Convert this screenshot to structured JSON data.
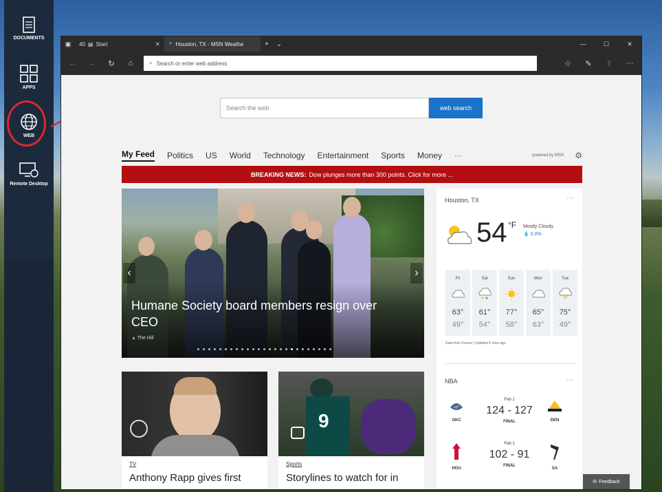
{
  "launcher": {
    "items": [
      {
        "label": "DOCUMENTS",
        "icon": "document-icon"
      },
      {
        "label": "APPS",
        "icon": "apps-grid-icon"
      },
      {
        "label": "WEB",
        "icon": "globe-icon"
      },
      {
        "label": "Remote Desktop",
        "icon": "remote-desktop-icon"
      }
    ]
  },
  "browser": {
    "tabs": {
      "start_count": "40",
      "start_label": "Start",
      "active_label": "Houston, TX - MSN Weathe"
    },
    "address_placeholder": "Search or enter web address"
  },
  "page": {
    "search_placeholder": "Search the web",
    "search_button": "web search",
    "feed_nav": [
      "My Feed",
      "Politics",
      "US",
      "World",
      "Technology",
      "Entertainment",
      "Sports",
      "Money"
    ],
    "feed_more": "···",
    "powered_by": "powered by MSN",
    "breaking_label": "BREAKING NEWS:",
    "breaking_text": "Dow plunges more than 300 points. Click for more ...",
    "hero": {
      "title": "Humane Society board members resign over CEO",
      "source": "The Hill"
    },
    "cards": [
      {
        "category": "TV",
        "title": "Anthony Rapp gives first"
      },
      {
        "category": "Sports",
        "title": "Storylines to watch for in"
      }
    ]
  },
  "weather": {
    "location": "Houston, TX",
    "more": "···",
    "temp": "54",
    "unit": "°F",
    "condition": "Mostly Cloudy",
    "precip": "0.0%",
    "forecast": [
      {
        "day": "Fri",
        "hi": "63°",
        "lo": "49°",
        "icon": "cloudy-icon"
      },
      {
        "day": "Sat",
        "hi": "61°",
        "lo": "54°",
        "icon": "rain-icon"
      },
      {
        "day": "Sun",
        "hi": "77°",
        "lo": "58°",
        "icon": "sunny-icon"
      },
      {
        "day": "Mon",
        "hi": "65°",
        "lo": "63°",
        "icon": "cloudy-icon"
      },
      {
        "day": "Tue",
        "hi": "75°",
        "lo": "49°",
        "icon": "storm-icon"
      }
    ],
    "source": "Data from Foreca | Updated 6 mins ago"
  },
  "nba": {
    "label": "NBA",
    "more": "···",
    "games": [
      {
        "date": "Feb 1",
        "score": "124 - 127",
        "status": "FINAL",
        "home": "OKC",
        "away": "DEN"
      },
      {
        "date": "Feb 1",
        "score": "102 - 91",
        "status": "FINAL",
        "home": "HOU",
        "away": "SA"
      }
    ]
  },
  "feedback": "Feedback",
  "colors": {
    "accent": "#1a73c9",
    "breaking": "#b30f12",
    "annotation": "#e0262b",
    "launcher": "#1b2a3c"
  }
}
